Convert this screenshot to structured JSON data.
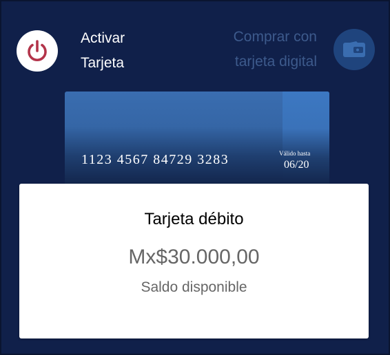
{
  "actions": {
    "activate": {
      "line1": "Activar",
      "line2": "Tarjeta",
      "icon": "power-icon",
      "icon_color": "#b3344a"
    },
    "buy_digital": {
      "line1": "Comprar con",
      "line2": "tarjeta digital",
      "icon": "wallet-icon",
      "label_color": "#3d5a8c"
    }
  },
  "card": {
    "number": "1123 4567 84729 3283",
    "valid_label": "Válido hasta",
    "valid_date": "06/20"
  },
  "balance": {
    "title": "Tarjeta débito",
    "amount": "Mx$30.000,00",
    "caption": "Saldo disponible"
  },
  "colors": {
    "background": "#10204a",
    "card_blue": "#3566a6",
    "panel": "#ffffff"
  }
}
